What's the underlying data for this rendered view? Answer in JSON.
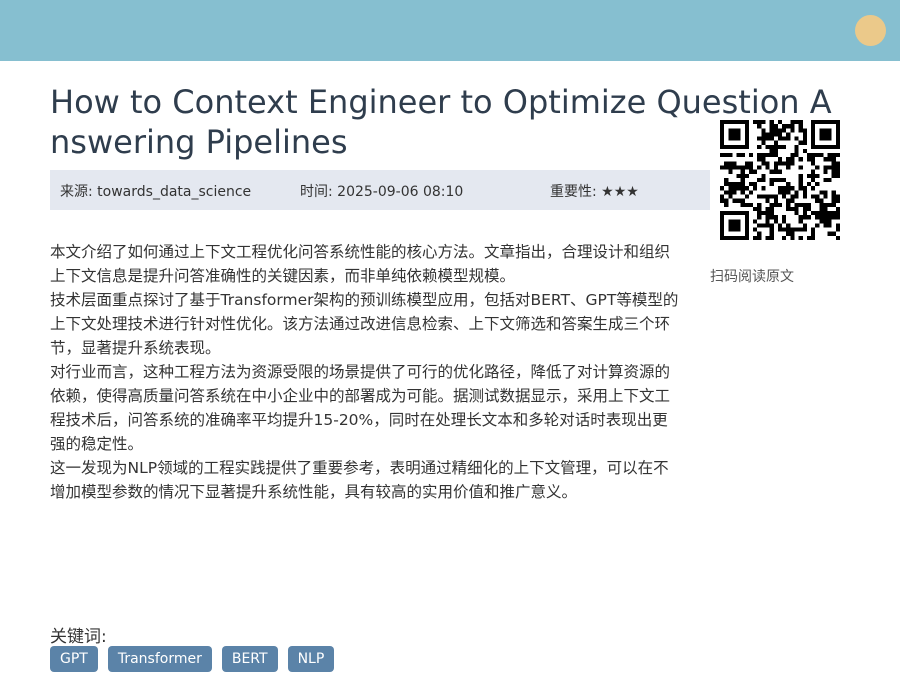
{
  "header": {
    "decoration_color": "#86bfd0",
    "dot_color": "#ebc98a"
  },
  "article": {
    "title": "How to Context Engineer to Optimize Question Answering Pipelines",
    "meta": {
      "source": "来源: towards_data_science",
      "time": "时间: 2025-09-06 08:10",
      "importance": "重要性: ★★★"
    },
    "paragraphs": [
      "本文介绍了如何通过上下文工程优化问答系统性能的核心方法。文章指出，合理设计和组织上下文信息是提升问答准确性的关键因素，而非单纯依赖模型规模。",
      "技术层面重点探讨了基于Transformer架构的预训练模型应用，包括对BERT、GPT等模型的上下文处理技术进行针对性优化。该方法通过改进信息检索、上下文筛选和答案生成三个环节，显著提升系统表现。",
      "对行业而言，这种工程方法为资源受限的场景提供了可行的优化路径，降低了对计算资源的依赖，使得高质量问答系统在中小企业中的部署成为可能。据测试数据显示，采用上下文工程技术后，问答系统的准确率平均提升15-20%，同时在处理长文本和多轮对话时表现出更强的稳定性。",
      "这一发现为NLP领域的工程实践提供了重要参考，表明通过精细化的上下文管理，可以在不增加模型参数的情况下显著提升系统性能，具有较高的实用价值和推广意义。"
    ]
  },
  "qr": {
    "caption": "扫码阅读原文"
  },
  "keywords": {
    "label": "关键词:",
    "tags": [
      "GPT",
      "Transformer",
      "BERT",
      "NLP"
    ],
    "tag_color": "#5b83a8"
  }
}
